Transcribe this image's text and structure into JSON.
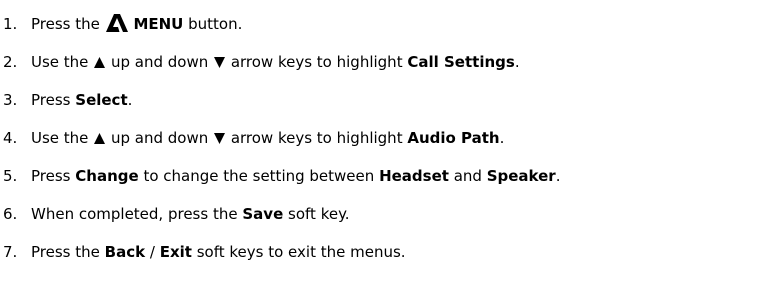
{
  "steps": [
    {
      "num": "1.",
      "a": "Press the",
      "b": "MENU",
      "c": "button."
    },
    {
      "num": "2.",
      "a": "Use the",
      "b": "up and down",
      "c": "arrow keys to highlight",
      "d": "Call Settings",
      "e": "."
    },
    {
      "num": "3.",
      "a": "Press",
      "b": "Select",
      "c": "."
    },
    {
      "num": "4.",
      "a": "Use the",
      "b": "up and down",
      "c": "arrow keys to highlight",
      "d": "Audio Path",
      "e": "."
    },
    {
      "num": "5.",
      "a": "Press",
      "b": "Change",
      "c": "to change the setting between",
      "d": "Headset",
      "e": "and",
      "f": "Speaker",
      "g": "."
    },
    {
      "num": "6.",
      "a": "When completed, press the",
      "b": "Save",
      "c": "soft key."
    },
    {
      "num": "7.",
      "a": "Press the",
      "b": "Back",
      "c": "/",
      "d": "Exit",
      "e": "soft keys to exit the menus."
    }
  ],
  "icons": {
    "menu": "avaya-a-logo-icon",
    "up": "up-triangle-icon",
    "down": "down-triangle-icon"
  }
}
